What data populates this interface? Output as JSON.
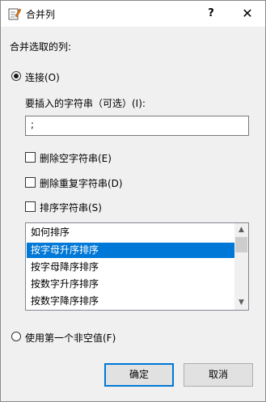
{
  "window": {
    "title": "合并列",
    "help_label": "?",
    "close_label": "✕"
  },
  "dialog": {
    "section_label": "合并选取的列:",
    "radio_join_label": "连接(O)",
    "insert_label": "要插入的字符串（可选）(I):",
    "insert_value": ";",
    "check_remove_empty_label": "删除空字符串(E)",
    "check_remove_dup_label": "删除重复字符串(D)",
    "check_sort_label": "排序字符串(S)",
    "sort_options": [
      {
        "label": "如何排序",
        "selected": false
      },
      {
        "label": "按字母升序排序",
        "selected": true
      },
      {
        "label": "按字母降序排序",
        "selected": false
      },
      {
        "label": "按数字升序排序",
        "selected": false
      },
      {
        "label": "按数字降序排序",
        "selected": false
      }
    ],
    "radio_first_nonempty_label": "使用第一个非空值(F)",
    "ok_label": "确定",
    "cancel_label": "取消"
  }
}
